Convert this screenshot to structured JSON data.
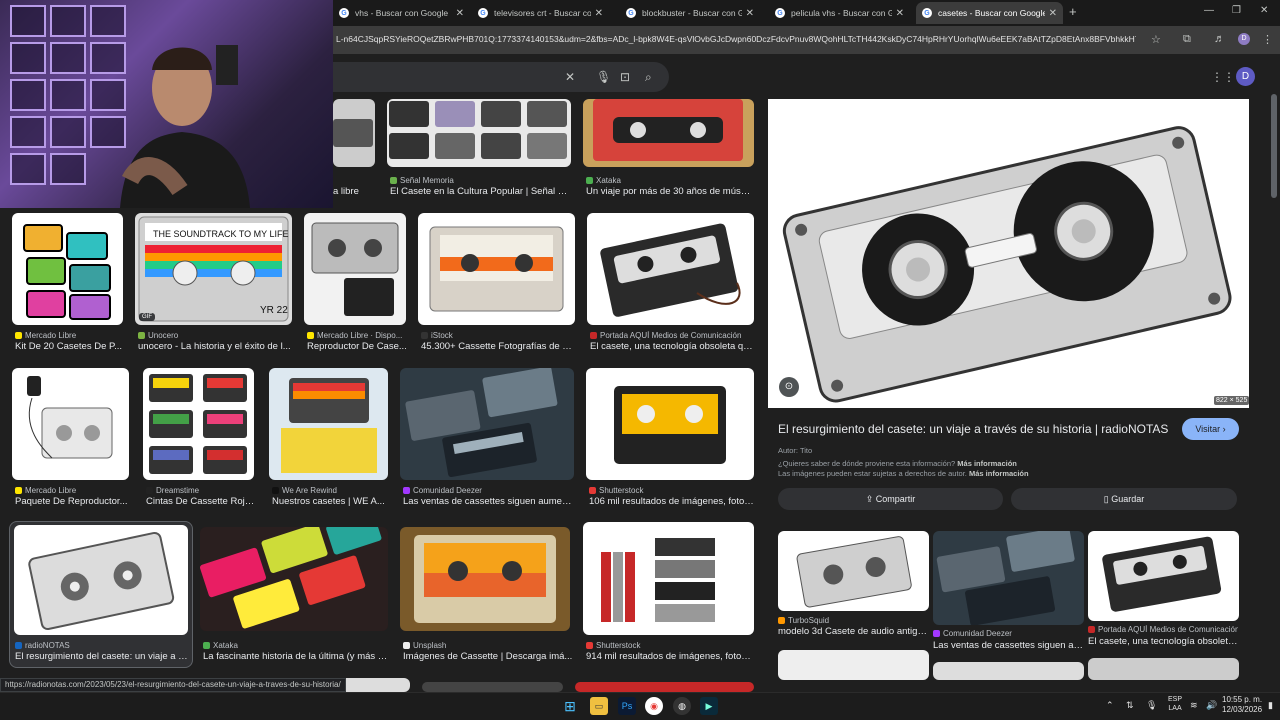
{
  "tabs": [
    {
      "title": "vhs - Buscar con Google",
      "active": false
    },
    {
      "title": "televisores crt - Buscar con Go",
      "active": false
    },
    {
      "title": "blockbuster - Buscar con Goog",
      "active": false
    },
    {
      "title": "pelicula vhs - Buscar con Goog",
      "active": false
    },
    {
      "title": "casetes - Buscar con Google",
      "active": true
    }
  ],
  "address": {
    "url": "L-n64CJSqpRSYieROQetZBRwPHB701Q:1773374140153&udm=2&fbs=ADc_l-bpk8W4E-qsVlOvbGJcDwpn60DczFdcvPnuv8WQohHLTcTH442KskDyC74HpRHrYUorhqlWu6eEEK7aBAtTZpD8EtAnx8BFVbhkkH7NL..."
  },
  "profile_letter": "D",
  "google_avatar_letter": "D",
  "icons": {
    "close": "close-icon",
    "mic": "mic-icon",
    "lens": "lens-icon",
    "search": "search-icon",
    "apps": "apps-grid-icon"
  },
  "grid": {
    "row0": [
      {
        "source": "",
        "caption": "a libre"
      },
      {
        "source": "Señal Memoria",
        "caption": "El Casete en la Cultura Popular | Señal M..."
      },
      {
        "source": "Xataka",
        "caption": "Un viaje por más de 30 años de músic..."
      }
    ],
    "row1": [
      {
        "source": "Mercado Libre",
        "caption": "Kit De 20 Casetes De P..."
      },
      {
        "source": "Unocero",
        "caption": "unocero - La historia y el éxito de l...",
        "badge": "GIF"
      },
      {
        "source": "Mercado Libre · Dispo...",
        "caption": "Reproductor De Case..."
      },
      {
        "source": "iStock",
        "caption": "45.300+ Cassette Fotografías de st..."
      },
      {
        "source": "Portada AQUÍ Medios de Comunicación",
        "caption": "El casete, una tecnología obsoleta qu..."
      }
    ],
    "row2": [
      {
        "source": "Mercado Libre",
        "caption": "Paquete De Reproductor..."
      },
      {
        "source": "Dreamstime",
        "caption": "Cintas De Cassette Roja..."
      },
      {
        "source": "We Are Rewind",
        "caption": "Nuestros casetes | WE A..."
      },
      {
        "source": "Comunidad Deezer",
        "caption": "Las ventas de cassettes siguen aument..."
      },
      {
        "source": "Shutterstock",
        "caption": "106 mil resultados de imágenes, fotos..."
      }
    ],
    "row3": [
      {
        "source": "radioNOTAS",
        "caption": "El resurgimiento del casete: un viaje a tr..."
      },
      {
        "source": "Xataka",
        "caption": "La fascinante historia de la última (y más e..."
      },
      {
        "source": "Unsplash",
        "caption": "Imágenes de Cassette | Descarga imá..."
      },
      {
        "source": "Shutterstock",
        "caption": "914 mil resultados de imágenes, fotos ..."
      }
    ]
  },
  "preview": {
    "dimensions": "822 × 525",
    "title": "El resurgimiento del casete: un viaje a través de su historia | radioNOTAS",
    "visit_label": "Visitar",
    "author": "Autor: Tito",
    "info_q": "¿Quieres saber de dónde proviene esta información?",
    "info_link": "Más información",
    "rights": "Las imágenes pueden estar sujetas a derechos de autor.",
    "rights_link": "Más información",
    "share_label": "Compartir",
    "save_label": "Guardar",
    "related": [
      {
        "source": "TurboSquid",
        "caption": "modelo 3d Casete de audio antigu..."
      },
      {
        "source": "Comunidad Deezer",
        "caption": "Las ventas de cassettes siguen au..."
      },
      {
        "source": "Portada AQUÍ Medios de Comunicación",
        "caption": "El casete, una tecnología obsoleta ..."
      }
    ]
  },
  "status_url": "https://radionotas.com/2023/05/23/el-resurgimiento-del-casete-un-viaje-a-traves-de-su-historia/",
  "taskbar": {
    "lang": "ESP",
    "layout": "LAA",
    "time": "10:55 p. m.",
    "date": "12/03/2026",
    "apps": [
      "start-icon",
      "file-explorer-icon",
      "photoshop-icon",
      "chrome-icon",
      "obs-icon",
      "app-icon"
    ]
  },
  "colors": {
    "accent": "#8ab4f8",
    "panel": "#1f1f1f",
    "tab_active": "#3c3c3c"
  }
}
